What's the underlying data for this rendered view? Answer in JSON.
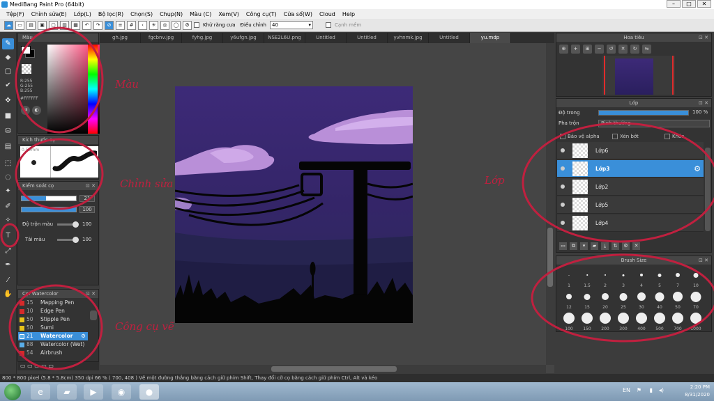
{
  "window": {
    "title": "MediBang Paint Pro (64bit)"
  },
  "menu": [
    "Tệp(F)",
    "Chỉnh sửa(E)",
    "Lớp(L)",
    "Bộ lọc(R)",
    "Chọn(S)",
    "Chụp(N)",
    "Màu (C)",
    "Xem(V)",
    "Công cụ(T)",
    "Cửa sổ(W)",
    "Cloud",
    "Help"
  ],
  "toolbar": {
    "antialias_label": "Khử răng cưa",
    "adjust_label": "Điều chỉnh",
    "adjust_value": "40",
    "snap_label": "Cạnh mềm"
  },
  "tabs": [
    "gh.jpg",
    "fgcbnv.jpg",
    "fyhg.jpg",
    "y6ufgn.jpg",
    "NSE2L6U.png",
    "Untitled",
    "Untitled",
    "yvhnmk.jpg",
    "Untitled",
    "yu.mdp"
  ],
  "active_tab": 9,
  "color_panel": {
    "title": "Màu",
    "r": "R:255",
    "g": "G:255",
    "b": "B:255",
    "hex": "#FFFFFF"
  },
  "brush_panel": {
    "title": "Kích thước cọ",
    "size_text": "0.59mm"
  },
  "brush_control": {
    "title": "Kiểm soát cọ",
    "size_value": "21",
    "opacity_value": "100",
    "mix_label": "Độ trộn màu",
    "mix_value": "100",
    "load_label": "Tải màu",
    "load_value": "100",
    "size_fraction": 0.45,
    "opacity_fraction": 1.0
  },
  "brush_list": {
    "title": "Cọ: Watercolor",
    "items": [
      {
        "num": "15",
        "name": "Mapping Pen",
        "color": "#d62a2a"
      },
      {
        "num": "10",
        "name": "Edge Pen",
        "color": "#d62a2a"
      },
      {
        "num": "50",
        "name": "Stipple Pen",
        "color": "#e6c21a"
      },
      {
        "num": "50",
        "name": "Sumi",
        "color": "#e6c21a"
      },
      {
        "num": "21",
        "name": "Watercolor",
        "color": "#5aaee8",
        "selected": true
      },
      {
        "num": "88",
        "name": "Watercolor (Wet)",
        "color": "#5aaee8"
      },
      {
        "num": "54",
        "name": "Airbrush",
        "color": "#d62a2a"
      }
    ]
  },
  "navigator": {
    "title": "Hoa tiêu"
  },
  "layers": {
    "title": "Lớp",
    "opacity_label": "Độ trong",
    "opacity_value": "100 %",
    "blend_label": "Pha trộn",
    "blend_value": "Bình thường",
    "protect_label": "Bảo vệ alpha",
    "clip_label": "Xén bớt",
    "lock_label": "Khóa",
    "items": [
      {
        "name": "Lớp6"
      },
      {
        "name": "Lớp3",
        "selected": true
      },
      {
        "name": "Lớp2"
      },
      {
        "name": "Lớp5"
      },
      {
        "name": "Lớp4"
      }
    ]
  },
  "brush_size": {
    "title": "Brush Size",
    "rows": [
      [
        "1",
        "1.5",
        "2",
        "3",
        "4",
        "5",
        "7",
        "10"
      ],
      [
        "12",
        "15",
        "20",
        "25",
        "30",
        "40",
        "50",
        "70"
      ],
      [
        "100",
        "150",
        "200",
        "300",
        "400",
        "500",
        "700",
        "1000"
      ]
    ]
  },
  "status": "800 * 800 pixel   (5.8 * 5.8cm)   350 dpi   66 %   ( 700, 408 )   Vẽ một đường thẳng bằng cách giữ phím Shift, Thay đổi cỡ cọ bằng cách giữ phím Ctrl, Alt và kéo",
  "taskbar": {
    "lang": "EN",
    "time": "2:20 PM",
    "date": "8/31/2020"
  },
  "annotations": {
    "color": "Màu",
    "brush": "Chỉnh sửa",
    "layer": "Lớp",
    "tool": "Công cụ vẽ"
  },
  "colors": {
    "accent": "#3a8fd9",
    "annotation": "#c0203f",
    "sky_top": "#3d2a78",
    "cloud": "#b98fd8"
  }
}
